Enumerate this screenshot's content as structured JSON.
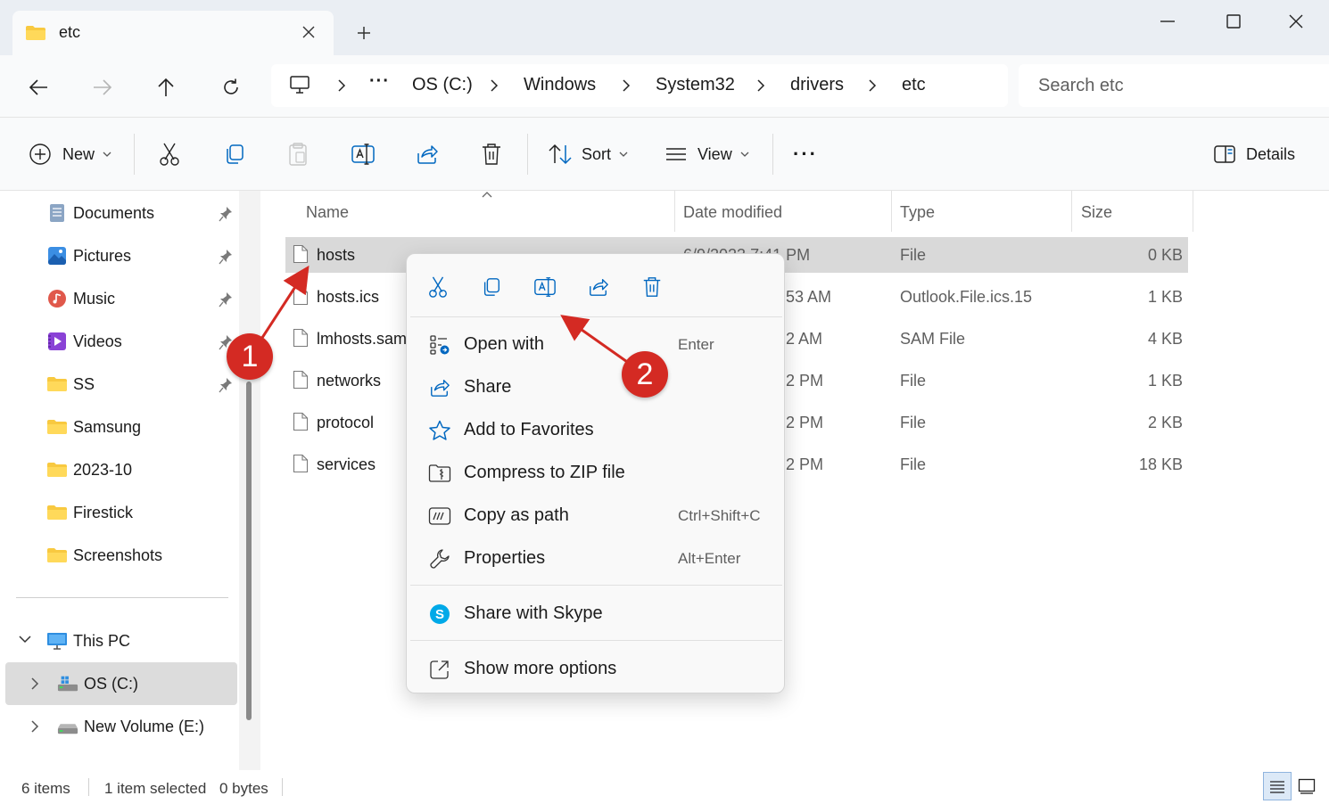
{
  "window": {
    "tab_title": "etc",
    "tab_close": "×",
    "new_tab": "+"
  },
  "nav": {
    "breadcrumbs": [
      "OS (C:)",
      "Windows",
      "System32",
      "drivers",
      "etc"
    ],
    "overflow": "···",
    "search_placeholder": "Search etc"
  },
  "toolbar": {
    "new_label": "New",
    "sort_label": "Sort",
    "view_label": "View",
    "more": "···",
    "details_label": "Details"
  },
  "sidebar": {
    "quick_access": [
      {
        "label": "Documents",
        "icon": "documents-icon",
        "pinned": true
      },
      {
        "label": "Pictures",
        "icon": "pictures-icon",
        "pinned": true
      },
      {
        "label": "Music",
        "icon": "music-icon",
        "pinned": true
      },
      {
        "label": "Videos",
        "icon": "videos-icon",
        "pinned": true
      },
      {
        "label": "SS",
        "icon": "folder-icon",
        "pinned": true
      },
      {
        "label": "Samsung",
        "icon": "folder-icon",
        "pinned": false
      },
      {
        "label": "2023-10",
        "icon": "folder-icon",
        "pinned": false
      },
      {
        "label": "Firestick",
        "icon": "folder-icon",
        "pinned": false
      },
      {
        "label": "Screenshots",
        "icon": "folder-icon",
        "pinned": false
      }
    ],
    "this_pc": "This PC",
    "drives": [
      {
        "label": "OS (C:)",
        "selected": true
      },
      {
        "label": "New Volume (E:)",
        "selected": false
      }
    ]
  },
  "columns": {
    "name": "Name",
    "date": "Date modified",
    "type": "Type",
    "size": "Size"
  },
  "files": [
    {
      "name": "hosts",
      "date": "6/9/2023 7:41 PM",
      "type": "File",
      "size": "0 KB",
      "selected": true
    },
    {
      "name": "hosts.ics",
      "date": "53 AM",
      "type": "Outlook.File.ics.15",
      "size": "1 KB",
      "selected": false
    },
    {
      "name": "lmhosts.sam",
      "date": "2 AM",
      "type": "SAM File",
      "size": "4 KB",
      "selected": false
    },
    {
      "name": "networks",
      "date": "2 PM",
      "type": "File",
      "size": "1 KB",
      "selected": false
    },
    {
      "name": "protocol",
      "date": "2 PM",
      "type": "File",
      "size": "2 KB",
      "selected": false
    },
    {
      "name": "services",
      "date": "2 PM",
      "type": "File",
      "size": "18 KB",
      "selected": false
    }
  ],
  "context_menu": {
    "items": [
      {
        "label": "Open with",
        "shortcut": "Enter"
      },
      {
        "label": "Share",
        "shortcut": ""
      },
      {
        "label": "Add to Favorites",
        "shortcut": ""
      },
      {
        "label": "Compress to ZIP file",
        "shortcut": ""
      },
      {
        "label": "Copy as path",
        "shortcut": "Ctrl+Shift+C"
      },
      {
        "label": "Properties",
        "shortcut": "Alt+Enter"
      },
      {
        "label": "Share with Skype",
        "shortcut": ""
      },
      {
        "label": "Show more options",
        "shortcut": ""
      }
    ]
  },
  "status": {
    "items": "6 items",
    "selection": "1 item selected",
    "size": "0 bytes"
  },
  "annotations": {
    "badge1": "1",
    "badge2": "2"
  },
  "colors": {
    "accent": "#0067c0",
    "annotation_red": "#d42a23",
    "folder_yellow": "#f8c940"
  }
}
